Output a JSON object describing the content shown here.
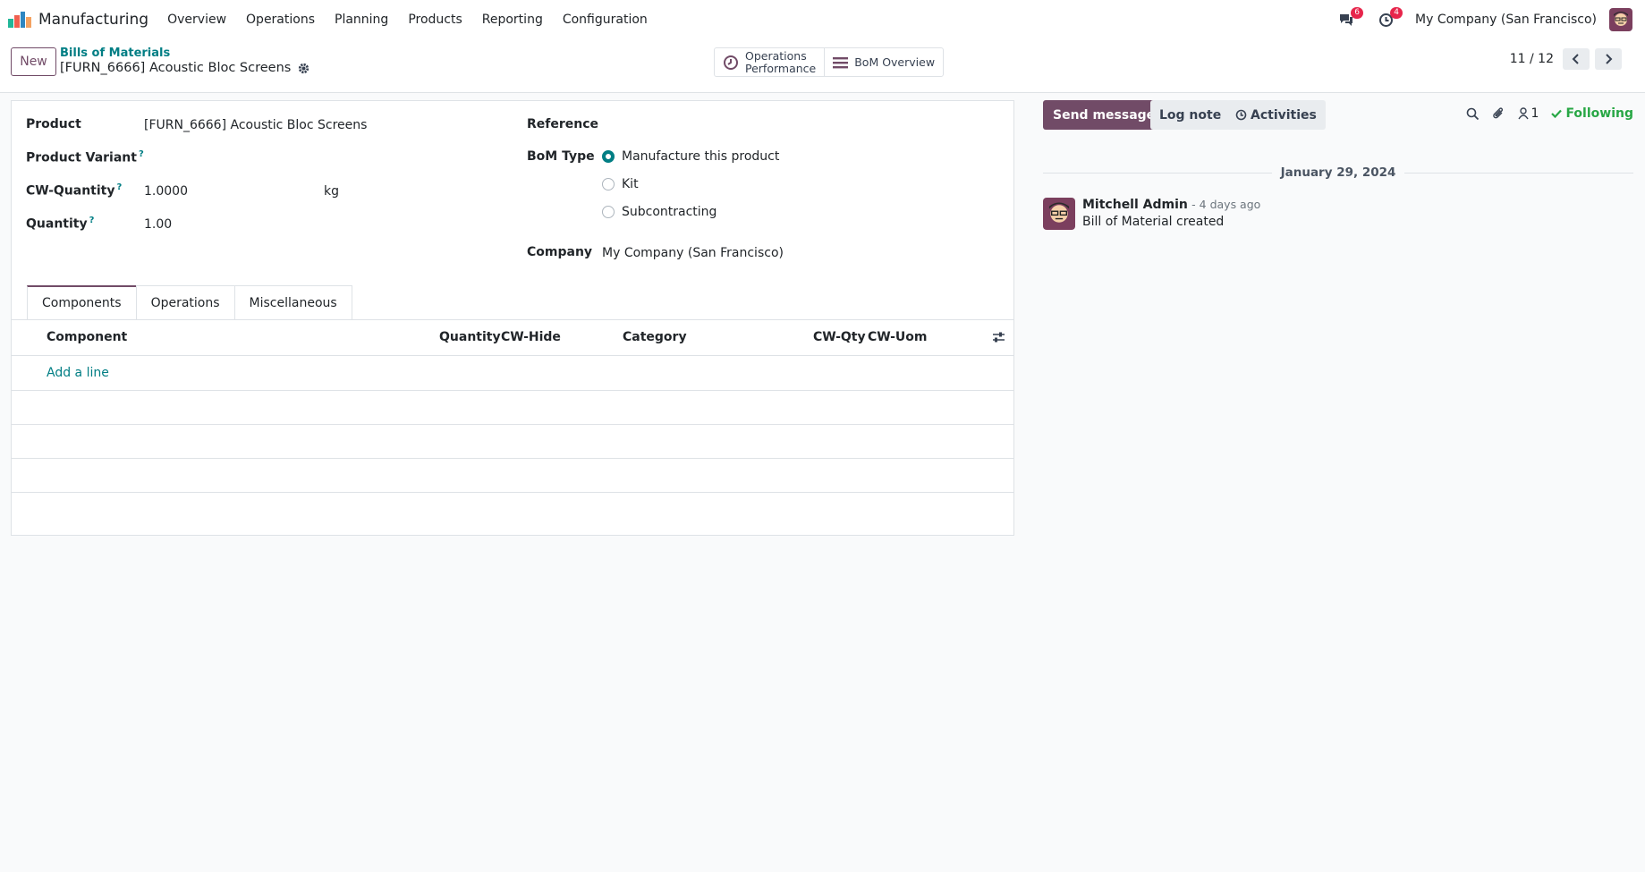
{
  "nav": {
    "app_name": "Manufacturing",
    "menu": [
      "Overview",
      "Operations",
      "Planning",
      "Products",
      "Reporting",
      "Configuration"
    ],
    "messages_count": "6",
    "activities_count": "4",
    "company": "My Company (San Francisco)"
  },
  "control": {
    "new_label": "New",
    "breadcrumb_parent": "Bills of Materials",
    "breadcrumb_current": "[FURN_6666] Acoustic Bloc Screens",
    "smart_ops_line1": "Operations",
    "smart_ops_line2": "Performance",
    "smart_bom": "BoM Overview",
    "pager": "11 / 12"
  },
  "form": {
    "product_label": "Product",
    "product_value": "[FURN_6666] Acoustic Bloc Screens",
    "variant_label": "Product Variant",
    "cwqty_label": "CW-Quantity",
    "cwqty_value": "1.0000",
    "cwqty_unit": "kg",
    "qty_label": "Quantity",
    "qty_value": "1.00",
    "help_mark": "?",
    "reference_label": "Reference",
    "bomtype_label": "BoM Type",
    "bomtype_options": [
      "Manufacture this product",
      "Kit",
      "Subcontracting"
    ],
    "company_label": "Company",
    "company_value": "My Company (San Francisco)"
  },
  "tabs": [
    "Components",
    "Operations",
    "Miscellaneous"
  ],
  "table": {
    "columns": [
      "Component",
      "Quantity",
      "CW-Hide",
      "Category",
      "CW-Qty",
      "CW-Uom"
    ],
    "add_line": "Add a line"
  },
  "chatter": {
    "send_message": "Send message",
    "log_note": "Log note",
    "activities": "Activities",
    "followers_count": "1",
    "following": "Following",
    "date": "January 29, 2024",
    "author": "Mitchell Admin",
    "ago": "- 4 days ago",
    "body": "Bill of Material created"
  },
  "colors": {
    "brand": "#714b67",
    "link": "#017e84",
    "success": "#28a745",
    "badge": "#e7254b"
  }
}
